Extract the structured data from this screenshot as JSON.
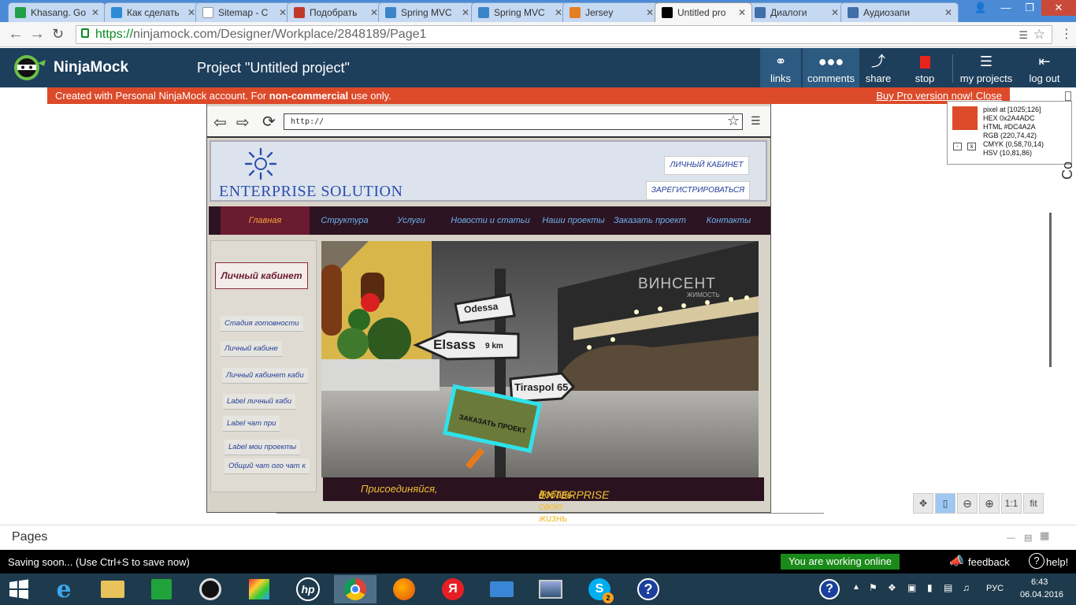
{
  "browser": {
    "tabs": [
      {
        "title": "Khasang. Go",
        "color": "#20a04a"
      },
      {
        "title": "Как сделать",
        "color": "#2d8ad6"
      },
      {
        "title": "Sitemap - C",
        "color": "#ffffff"
      },
      {
        "title": "Подобрать",
        "color": "#c0392b"
      },
      {
        "title": "Spring MVC",
        "color": "#3a84c9"
      },
      {
        "title": "Spring MVC",
        "color": "#3a84c9"
      },
      {
        "title": "Jersey",
        "color": "#e67e22"
      },
      {
        "title": "Untitled pro",
        "color": "#000000"
      },
      {
        "title": "Диалоги",
        "color": "#3f6ea8"
      },
      {
        "title": "Аудиозапи",
        "color": "#3f6ea8"
      }
    ],
    "url_scheme": "https://",
    "url_rest": "ninjamock.com/Designer/Workplace/2848189/Page1"
  },
  "app": {
    "name": "NinjaMock",
    "project_title": "Project \"Untitled project\"",
    "toolbar": {
      "links": "links",
      "comments": "comments",
      "share": "share",
      "stop": "stop",
      "my_projects": "my projects",
      "log_out": "log out"
    },
    "banner": {
      "pre": "Created with Personal NinjaMock account. For ",
      "bold": "non-commercial",
      "post": " use only.",
      "pro_link": "Buy Pro version now! Close"
    }
  },
  "mockup": {
    "address_placeholder": "http://",
    "site_title": "ENTERPRISE SOLUTION",
    "header_buttons": [
      "ЛИЧНЫЙ КАБИНЕТ",
      "ЗАРЕГИСТРИРОВАТЬСЯ"
    ],
    "nav": [
      "Главная",
      "Структура",
      "Услуги",
      "Новости и статьи",
      "Наши проекты",
      "Заказать проект",
      "Контакты"
    ],
    "sidebar_title": "Личный кабинет",
    "sidebar_items": [
      "Стадия готовности",
      "Личный кабине",
      "Личный кабинет каби",
      "Label личный каби",
      "Label чат при",
      "Label мои проекты",
      "Общий чат ого чат к"
    ],
    "hero": {
      "sign_odessa": "Odessa",
      "sign_elsass": "Elsass",
      "sign_km": "9 km",
      "sign_tiraspol": "Tiraspol 65",
      "order_button": "ЗАКАЗАТЬ ПРОЕКТ",
      "watermark": "ВИНСЕНТ",
      "watermark_sub": "ЖИМОСТЬ"
    },
    "footer_left": "Присоединяйся,",
    "footer_right_pre": "добавь ",
    "footer_right_em": "ENTERPRISE",
    "footer_right_post": " в свою жизнь"
  },
  "color_picker": {
    "pixel": "pixel at [1025;126]",
    "hex": "HEX 0x2A4ADC",
    "html": "HTML #DC4A2A",
    "rgb": "RGB (220,74,42)",
    "cmyk": "CMYK (0,58,70,14)",
    "hsv": "HSV (10,81,86)",
    "swatch": "#dc4a2a",
    "minus": "-",
    "close": "x"
  },
  "zoom_controls": {
    "actual": "1:1",
    "fit": "fit"
  },
  "right_panel_label": "Co",
  "pages_label": "Pages",
  "status": {
    "saving": "Saving soon... (Use Ctrl+S to save now)",
    "online": "You are working online",
    "feedback": "feedback",
    "help": "help!"
  },
  "taskbar": {
    "lang": "РУС",
    "time": "6:43",
    "date": "06.04.2016",
    "skype_badge": "2"
  }
}
